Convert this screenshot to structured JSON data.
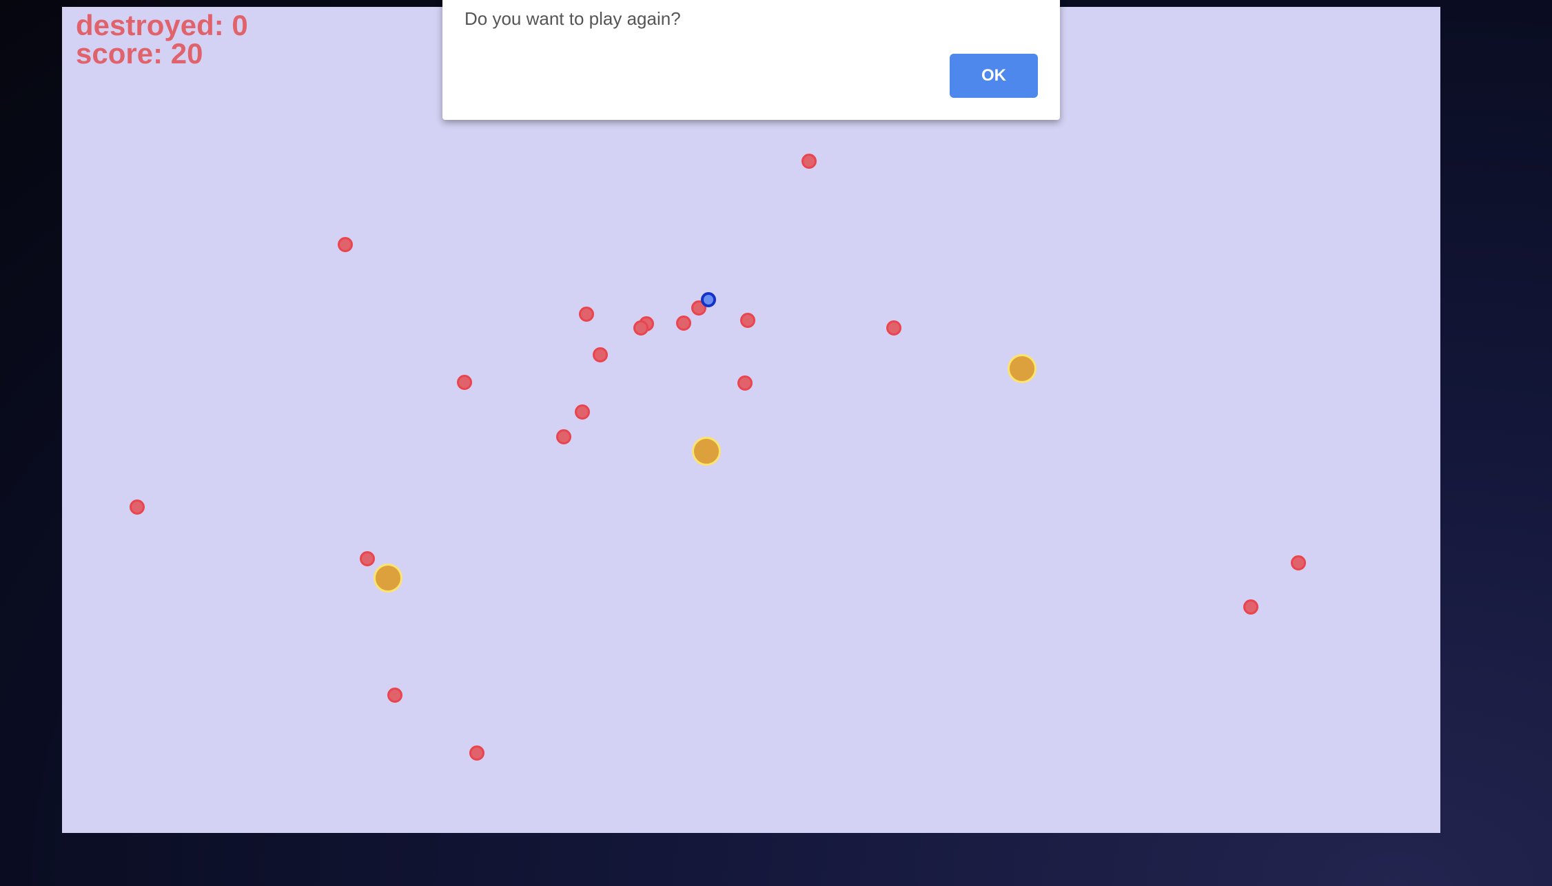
{
  "hud": {
    "destroyed_text": "destroyed: 0",
    "score_text": "score: 20",
    "destroyed_value": 0,
    "score_value": 20
  },
  "dialog": {
    "message": "Do you want to play again?",
    "ok_label": "OK"
  },
  "colors": {
    "canvas_background": "#d4d2f4",
    "hud_text": "#e0636c",
    "enemy": "#e0636c",
    "coin": "#dca13d",
    "player": "#1431c8",
    "ok_button": "#4e88ec"
  }
}
